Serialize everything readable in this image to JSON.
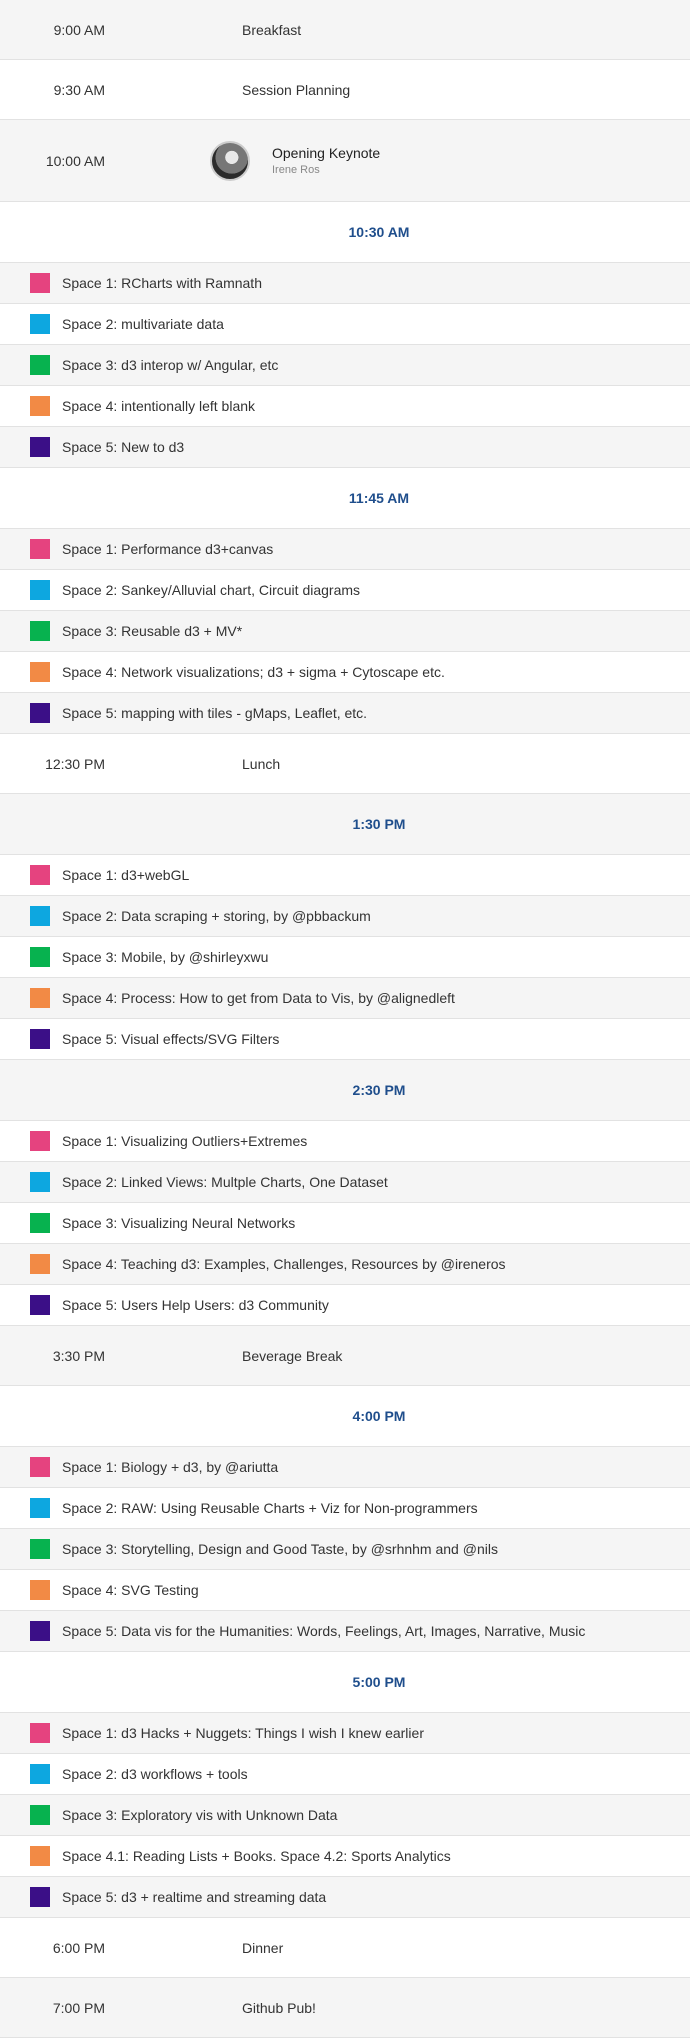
{
  "colors": {
    "space1": "#e5437f",
    "space2": "#0da7e0",
    "space3": "#07b24f",
    "space4": "#f28a45",
    "space5": "#3b0f87",
    "header_text": "#1f4e8c"
  },
  "events": {
    "breakfast": {
      "time": "9:00 AM",
      "title": "Breakfast"
    },
    "planning": {
      "time": "9:30 AM",
      "title": "Session Planning"
    },
    "keynote": {
      "time": "10:00 AM",
      "title": "Opening Keynote",
      "speaker": "Irene Ros"
    },
    "lunch": {
      "time": "12:30 PM",
      "title": "Lunch"
    },
    "beverage": {
      "time": "3:30 PM",
      "title": "Beverage Break"
    },
    "dinner": {
      "time": "6:00 PM",
      "title": "Dinner"
    },
    "pub": {
      "time": "7:00 PM",
      "title": "Github Pub!"
    }
  },
  "blocks": {
    "b1030": {
      "time": "10:30 AM",
      "sessions": [
        "Space 1: RCharts with Ramnath",
        "Space 2: multivariate data",
        "Space 3: d3 interop w/ Angular, etc",
        "Space 4: intentionally left blank",
        "Space 5: New to d3"
      ]
    },
    "b1145": {
      "time": "11:45 AM",
      "sessions": [
        "Space 1: Performance d3+canvas",
        "Space 2: Sankey/Alluvial chart, Circuit diagrams",
        "Space 3: Reusable d3 + MV*",
        "Space 4: Network visualizations; d3 + sigma + Cytoscape etc.",
        "Space 5: mapping with tiles - gMaps, Leaflet, etc."
      ]
    },
    "b130": {
      "time": "1:30 PM",
      "sessions": [
        "Space 1: d3+webGL",
        "Space 2: Data scraping + storing, by @pbbackum",
        "Space 3: Mobile, by @shirleyxwu",
        "Space 4: Process: How to get from Data to Vis, by @alignedleft",
        "Space 5: Visual effects/SVG Filters"
      ]
    },
    "b230": {
      "time": "2:30 PM",
      "sessions": [
        "Space 1: Visualizing Outliers+Extremes",
        "Space 2: Linked Views: Multple Charts, One Dataset",
        "Space 3: Visualizing Neural Networks",
        "Space 4: Teaching d3: Examples, Challenges, Resources by @ireneros",
        "Space 5: Users Help Users: d3 Community"
      ]
    },
    "b400": {
      "time": "4:00 PM",
      "sessions": [
        "Space 1: Biology + d3, by @ariutta",
        "Space 2: RAW: Using Reusable Charts + Viz for Non-programmers",
        "Space 3: Storytelling, Design and Good Taste, by @srhnhm and @nils",
        "Space 4: SVG Testing",
        "Space 5: Data vis for the Humanities: Words, Feelings, Art, Images, Narrative, Music"
      ]
    },
    "b500": {
      "time": "5:00 PM",
      "sessions": [
        "Space 1: d3 Hacks + Nuggets: Things I wish I knew earlier",
        "Space 2: d3 workflows + tools",
        "Space 3: Exploratory vis with Unknown Data",
        "Space 4.1: Reading Lists + Books. Space 4.2: Sports Analytics",
        "Space 5: d3 + realtime and streaming data"
      ]
    }
  }
}
